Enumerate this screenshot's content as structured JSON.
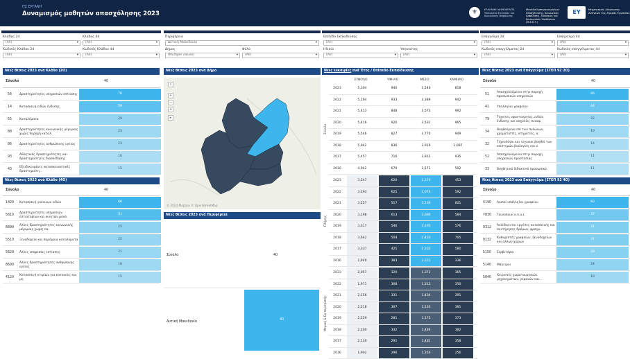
{
  "header": {
    "supertitle": "ΠΣ ΕΡΓΑΝΗ",
    "title": "Δυναμισμός μαθητών απασχόλησης 2023",
    "seal_glyph": "⚜",
    "hellenic": "ΕΛΛΗΝΙΚΗ ΔΗΜΟΚΡΑΤΙΑ Υπουργείο Εργασίας και Κοινωνικής Ασφάλισης",
    "ministry": "Μονάδα Εμπειρογνωμόνων Απασχόλησης, Κοινωνικής Ασφάλισης, Πρόνοιας και Κοινωνικών Υποθέσεων (Μ.Ε.Κ.Υ.)",
    "logo": "ΕΥ",
    "logo_text": "Μηχανισμός Διάγνωσης Αναγκών της Αγοράς Εργασίας"
  },
  "filters": {
    "kladoi2": {
      "label": "Κλάδος 2d",
      "value": "(All)"
    },
    "kladoi4": {
      "label": "Κλάδος 4d",
      "value": "(All)"
    },
    "kkl2": {
      "label": "Κωδικός Κλάδου 2d",
      "value": "(All)"
    },
    "kkl4": {
      "label": "Κωδικός Κλάδου 4d",
      "value": "(All)"
    },
    "perifereia": {
      "label": "Περιφέρεια",
      "value": "Δυτική Μακεδονία"
    },
    "dimos": {
      "label": "Δήμος",
      "value": "(Multiple values)"
    },
    "fylo": {
      "label": "Φύλο",
      "value": "(All)"
    },
    "ekp": {
      "label": "Επίπεδο Εκπαίδευσης",
      "value": "(All)"
    },
    "ilikia": {
      "label": "Ηλικία",
      "value": "(All)"
    },
    "ypikootita": {
      "label": "Υπηκοότης",
      "value": "(All)"
    },
    "epag2": {
      "label": "Επάγγελμα 2d",
      "value": "(All)"
    },
    "epag4": {
      "label": "Επάγγελμα 4d",
      "value": "(All)"
    },
    "kep2": {
      "label": "Κωδικός επαγγέλματος 2d",
      "value": "(All)"
    },
    "kep4": {
      "label": "Κωδικός επαγγέλματος 4d",
      "value": "(All)"
    }
  },
  "panel_kl2": {
    "title": "Νέες θέσεις 2023 ανά Κλάδο (2Ο)",
    "total_label": "Σύνολο",
    "total": "40",
    "rows": [
      {
        "code": "56",
        "name": "Δραστηριότητες υπηρεσιών εστίασης",
        "value": "76"
      },
      {
        "code": "14",
        "name": "Κατασκευή ειδών ένδυσης",
        "value": "59"
      },
      {
        "code": "55",
        "name": "Καταλύματα",
        "value": "29"
      },
      {
        "code": "88",
        "name": "Δραστηριότητες κοινωνικής μέριμνας χωρίς παροχή καταλ.",
        "value": "23"
      },
      {
        "code": "86",
        "name": "Δραστηριότητες ανθρώπινης υγείας",
        "value": "23"
      },
      {
        "code": "93",
        "name": "Αθλητικές δραστηριότητες και δραστηριότητες διασκέδασης",
        "value": "16"
      },
      {
        "code": "43",
        "name": "Εξειδικευμένες κατασκευαστικές δραστηριότη...",
        "value": "15"
      }
    ]
  },
  "panel_kl4": {
    "title": "Νέες θέσεις 2023 ανά Κλάδο (4Ο)",
    "total_label": "Σύνολο",
    "total": "40",
    "rows": [
      {
        "code": "1420",
        "name": "Κατασκευή γούνινων ειδών",
        "value": "60"
      },
      {
        "code": "5610",
        "name": "Δραστηριότητες υπηρεσιών εστιατορίων και κινητών μονά.",
        "value": "51"
      },
      {
        "code": "8899",
        "name": "Άλλες δραστηριότητες κοινωνικής μέριμνας χωρίς πα.",
        "value": "25"
      },
      {
        "code": "5510",
        "name": "Ξενοδοχεία και παρόμοια καταλύματα",
        "value": "22"
      },
      {
        "code": "5629",
        "name": "Άλλες υπηρεσίες εστίασης",
        "value": "21"
      },
      {
        "code": "8690",
        "name": "Άλλες δραστηριότητες ανθρώπινης υγείας",
        "value": "18"
      },
      {
        "code": "4120",
        "name": "Κατασκευή κτιρίων για κατοικίες και μη",
        "value": "15"
      }
    ]
  },
  "map": {
    "title": "Νέες θέσεις 2023 ανά Δήμο",
    "credit": "© 2024 Mapbox © OpenStreetMap"
  },
  "reg": {
    "title": "Νέες θέσεις 2023 ανά Περιφέρεια",
    "total_label": "Σύνολο",
    "total": "40",
    "region": "Δυτική Μακεδονία",
    "value": "40"
  },
  "grid": {
    "title_link": "Νέες ευκαιρίες",
    "title_rest": " ανά Έτος / Επίπεδο Εκπαίδευσης",
    "headers": [
      "ΣΥΝΟΛΟ",
      "ΥΨΗΛΟ",
      "ΜΕΣΟ",
      "ΧΑΜΗΛΟ"
    ],
    "groups": [
      {
        "name": "Σύνολο",
        "rows": [
          [
            "2023",
            "5,304",
            "940",
            "3,546",
            "818"
          ],
          [
            "2022",
            "5,264",
            "933",
            "3,389",
            "942"
          ],
          [
            "2021",
            "5,413",
            "848",
            "3,573",
            "992"
          ],
          [
            "2020",
            "5,416",
            "920",
            "3,531",
            "965"
          ],
          [
            "2019",
            "5,546",
            "827",
            "3,770",
            "949"
          ],
          [
            "2018",
            "5,942",
            "836",
            "3,919",
            "1,087"
          ],
          [
            "2017",
            "5,457",
            "716",
            "3,813",
            "935"
          ],
          [
            "2016",
            "4,942",
            "679",
            "3,571",
            "592"
          ]
        ]
      },
      {
        "name": "Πλήρης",
        "rows": [
          [
            "2023",
            "3,247",
            "620",
            "2,174",
            "453"
          ],
          [
            "2022",
            "3,293",
            "625",
            "2,076",
            "592"
          ],
          [
            "2021",
            "3,257",
            "517",
            "2,139",
            "601"
          ],
          [
            "2020",
            "3,198",
            "613",
            "2,080",
            "584"
          ],
          [
            "2019",
            "3,317",
            "546",
            "2,195",
            "576"
          ],
          [
            "2018",
            "3,642",
            "504",
            "2,433",
            "705"
          ],
          [
            "2017",
            "3,337",
            "425",
            "2,332",
            "580"
          ],
          [
            "2016",
            "2,940",
            "383",
            "2,221",
            "336"
          ]
        ]
      },
      {
        "name": "Μερική & Εκ περιτροπής",
        "rows": [
          [
            "2023",
            "2,057",
            "320",
            "1,372",
            "365"
          ],
          [
            "2022",
            "1,971",
            "308",
            "1,313",
            "350"
          ],
          [
            "2021",
            "2,156",
            "331",
            "1,434",
            "391"
          ],
          [
            "2020",
            "2,218",
            "307",
            "1,530",
            "381"
          ],
          [
            "2019",
            "2,229",
            "281",
            "1,575",
            "373"
          ],
          [
            "2018",
            "2,200",
            "332",
            "1,486",
            "382"
          ],
          [
            "2017",
            "2,130",
            "291",
            "1,481",
            "358"
          ],
          [
            "2016",
            "1,902",
            "296",
            "1,350",
            "256"
          ]
        ]
      }
    ]
  },
  "panel_ep2": {
    "title": "Νέες θέσεις 2023 ανά Επάγγελμα (ΣΤΕΠ 92 2Ο)",
    "total_label": "Σύνολο",
    "total": "40",
    "rows": [
      {
        "code": "51",
        "name": "Απασχολούμενοι στην παροχή προσωπικών υπηρεσιών",
        "value": "66"
      },
      {
        "code": "41",
        "name": "Υπάλληλοι γραφείου",
        "value": "44"
      },
      {
        "code": "79",
        "name": "Τεχνίτες υφαντουργίας, ειδών ένδυσης και ασχολίες συναφ.",
        "value": "22"
      },
      {
        "code": "34",
        "name": "Βοηθούμενα επί των πυλώνων, χρηματιστές, κτηματίες, α.",
        "value": "19"
      },
      {
        "code": "32",
        "name": "Τεχνολόγοι και τεχνικοί βοηθοί των επιστημών βιολογίας και υ.",
        "value": "14"
      },
      {
        "code": "52",
        "name": "Απασχολούμενοι στην παροχή υπηρεσιών προστασίας",
        "value": "11"
      },
      {
        "code": "33",
        "name": "Βοηθητικό διδακτικό προσωπικό",
        "value": "11"
      }
    ]
  },
  "panel_ep4": {
    "title": "Νέες θέσεις 2023 ανά Επάγγελμα (ΣΤΕΠ 92 4Ο)",
    "total_label": "Σύνολο",
    "total": "40",
    "rows": [
      {
        "code": "4190",
        "name": "Λοιποί υπάλληλοι γραφείου",
        "value": "60"
      },
      {
        "code": "7830",
        "name": "Γουνοποιοί κ.π.α.ε.",
        "value": "37"
      },
      {
        "code": "9312",
        "name": "Ανειδίκευτοι εργάτες κατασκευής και συντήρησης δρόμων, φραγμ.",
        "value": "31"
      },
      {
        "code": "9132",
        "name": "Καθαριστές γραφείων, ξενοδοχείων και άλλων χώρων",
        "value": "31"
      },
      {
        "code": "5150",
        "name": "Σερβιτόροι",
        "value": "28"
      },
      {
        "code": "5140",
        "name": "Μάγειροι",
        "value": "24"
      },
      {
        "code": "5840",
        "name": "Χειριστές χωματουργικών μηχανημάτων, γερανών και...",
        "value": "18"
      }
    ]
  },
  "icons": {
    "search": "⌕",
    "plus": "+",
    "minus": "−",
    "home": "⌂",
    "arrow": "▸",
    "dropdown": "▾"
  }
}
